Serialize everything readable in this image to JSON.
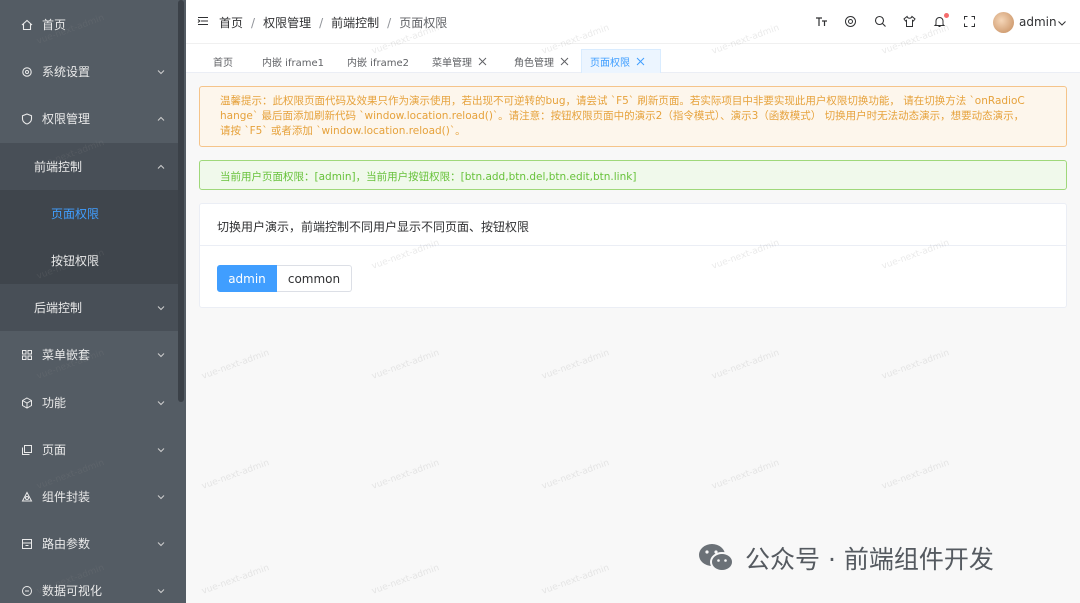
{
  "sidebar": {
    "items": [
      {
        "label": "首页",
        "icon": "home-icon"
      },
      {
        "label": "系统设置",
        "icon": "gear-icon"
      },
      {
        "label": "权限管理",
        "icon": "shield-icon"
      },
      {
        "label": "前端控制"
      },
      {
        "label": "页面权限"
      },
      {
        "label": "按钮权限"
      },
      {
        "label": "后端控制"
      },
      {
        "label": "菜单嵌套",
        "icon": "grid-icon"
      },
      {
        "label": "功能",
        "icon": "cube-icon"
      },
      {
        "label": "页面",
        "icon": "copy-icon"
      },
      {
        "label": "组件封装",
        "icon": "component-icon"
      },
      {
        "label": "路由参数",
        "icon": "box-icon"
      },
      {
        "label": "数据可视化",
        "icon": "chat-icon"
      }
    ]
  },
  "header": {
    "breadcrumb": [
      "首页",
      "权限管理",
      "前端控制",
      "页面权限"
    ],
    "breadcrumb_sep": "/",
    "user_name": "admin"
  },
  "tabs": [
    {
      "label": "首页",
      "closable": false
    },
    {
      "label": "内嵌 iframe1",
      "closable": false
    },
    {
      "label": "内嵌 iframe2",
      "closable": false
    },
    {
      "label": "菜单管理",
      "closable": true
    },
    {
      "label": "角色管理",
      "closable": true
    },
    {
      "label": "页面权限",
      "closable": true,
      "active": true
    }
  ],
  "alerts": {
    "warning_line1": "温馨提示：此权限页面代码及效果只作为演示使用，若出现不可逆转的bug，请尝试 `F5` 刷新页面。若实际项目中非要实现此用户权限切换功能， 请在切换方法 `onRadioC",
    "warning_line2": "hange` 最后面添加刷新代码 `window.location.reload()`。请注意：按钮权限页面中的演示2（指令模式）、演示3（函数模式） 切换用户时无法动态演示，想要动态演示，",
    "warning_line3": "请按 `F5` 或者添加 `window.location.reload()`。",
    "success": "当前用户页面权限：[admin]，当前用户按钮权限：[btn.add,btn.del,btn.edit,btn.link]"
  },
  "card": {
    "title": "切换用户演示，前端控制不同用户显示不同页面、按钮权限",
    "options": [
      "admin",
      "common"
    ],
    "selected": "admin"
  },
  "watermark": "vue-next-admin",
  "footer_brand": "公众号 · 前端组件开发",
  "colors": {
    "sidebar_bg": "#545c64",
    "active_text": "#409eff",
    "primary": "#409eff",
    "warning": "#e6a23c",
    "success": "#67c23a"
  }
}
